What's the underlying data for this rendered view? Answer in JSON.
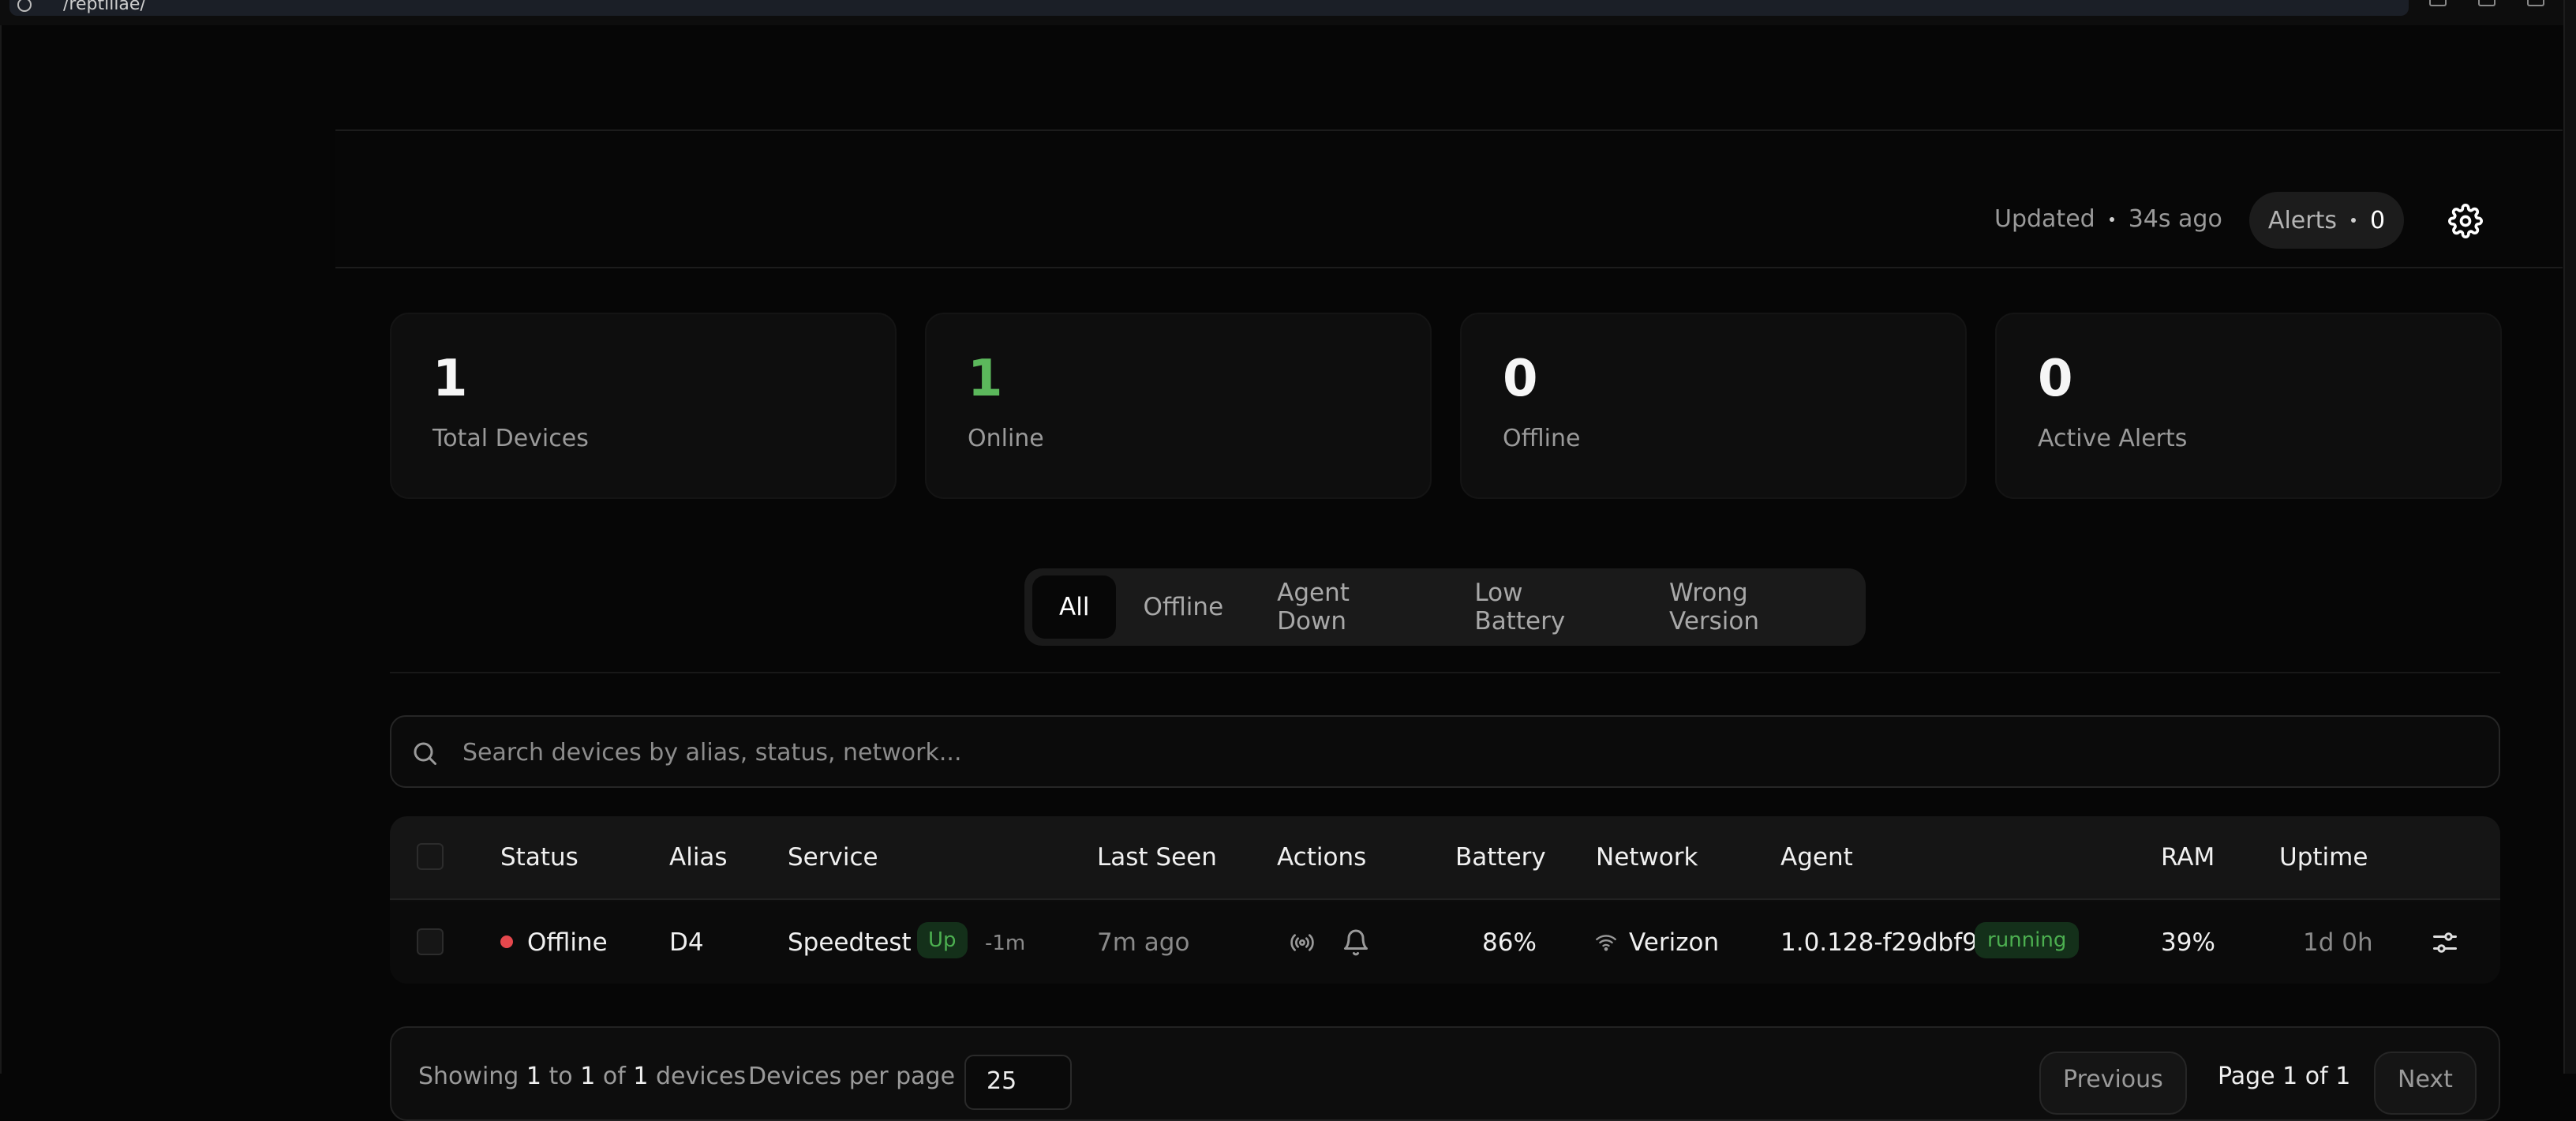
{
  "browser": {
    "url": "/reptiliae/"
  },
  "header": {
    "updated_label": "Updated",
    "updated_ago": "34s ago",
    "alerts_label": "Alerts",
    "alerts_count": "0",
    "settings_icon": "gear-icon"
  },
  "stats": [
    {
      "value": "1",
      "label": "Total Devices"
    },
    {
      "value": "1",
      "label": "Online",
      "color": "#5cb85c"
    },
    {
      "value": "0",
      "label": "Offline"
    },
    {
      "value": "0",
      "label": "Active Alerts"
    }
  ],
  "filters": {
    "tabs": [
      "All",
      "Offline",
      "Agent Down",
      "Low Battery",
      "Wrong Version"
    ],
    "active": "All"
  },
  "search": {
    "placeholder": "Search devices by alias, status, network...",
    "value": ""
  },
  "table": {
    "columns": [
      "Status",
      "Alias",
      "Service",
      "Last Seen",
      "Actions",
      "Battery",
      "Network",
      "Agent",
      "RAM",
      "Uptime"
    ],
    "rows": [
      {
        "status": "Offline",
        "status_color": "#e5484d",
        "alias": "D4",
        "service": "Speedtest",
        "service_badge": "Up",
        "service_delta": "-1m",
        "last_seen": "7m ago",
        "battery": "86%",
        "network": "Verizon",
        "agent_version": "1.0.128-f29dbf9",
        "agent_state": "running",
        "ram": "39%",
        "uptime": "1d 0h"
      }
    ]
  },
  "pager": {
    "showing_prefix": "Showing",
    "showing_from": "1",
    "showing_to_word": "to",
    "showing_to": "1",
    "showing_of_word": "of",
    "showing_total": "1",
    "showing_suffix": "devices",
    "per_page_label": "Devices per page",
    "per_page_value": "25",
    "previous": "Previous",
    "page_label": "Page 1 of 1",
    "next": "Next"
  },
  "colors": {
    "background": "#060606",
    "card": "#0e0e0e",
    "online_green": "#5cb85c",
    "offline_red": "#e5484d"
  }
}
